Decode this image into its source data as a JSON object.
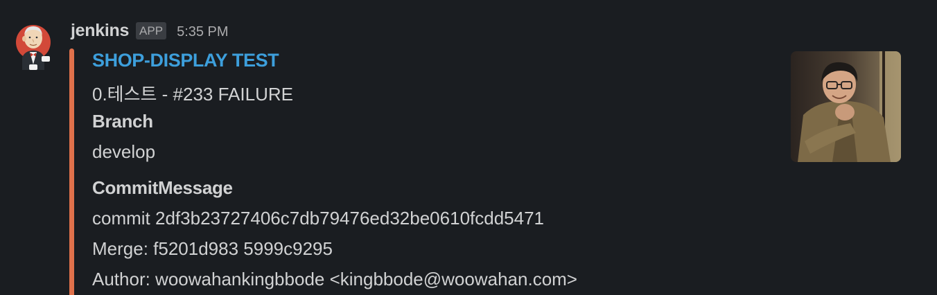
{
  "message": {
    "sender": "jenkins",
    "badge": "APP",
    "time": "5:35 PM",
    "accent_color": "#e0714b"
  },
  "attachment": {
    "title": "SHOP-DISPLAY TEST",
    "status_line": "0.테스트 - #233 FAILURE",
    "fields": [
      {
        "title": "Branch",
        "value": "develop"
      },
      {
        "title": "CommitMessage",
        "lines": [
          "commit 2df3b23727406c7db79476ed32be0610fcdd5471",
          "Merge: f5201d983 5999c9295",
          "Author: woowahankingbbode <kingbbode@woowahan.com>"
        ]
      }
    ]
  },
  "icons": {
    "avatar": "jenkins-butler-icon",
    "thumbnail": "user-photo-thumbnail"
  }
}
